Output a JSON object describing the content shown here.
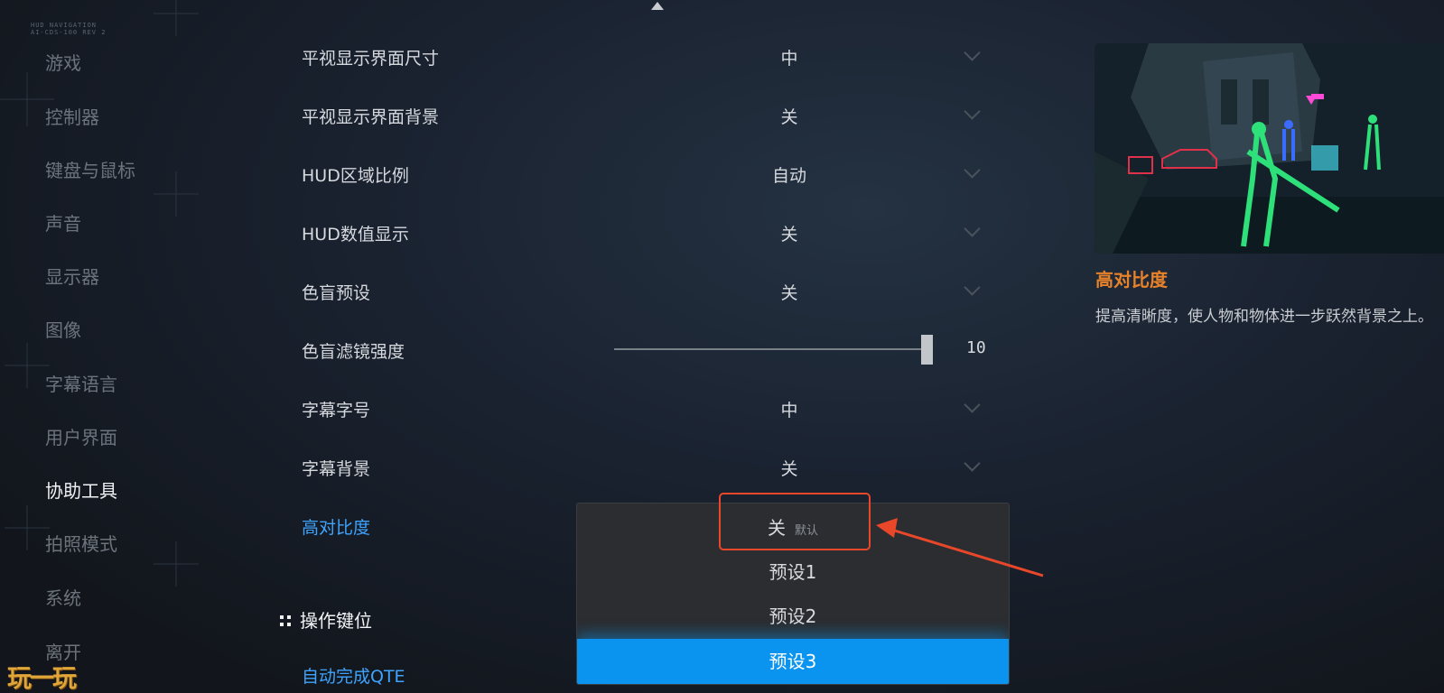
{
  "hud_tag": [
    "HUD NAVIGATION",
    "AI-CDS-100 REV 2"
  ],
  "sidebar": {
    "items": [
      {
        "label": "游戏"
      },
      {
        "label": "控制器"
      },
      {
        "label": "键盘与鼠标"
      },
      {
        "label": "声音"
      },
      {
        "label": "显示器"
      },
      {
        "label": "图像"
      },
      {
        "label": "字幕语言"
      },
      {
        "label": "用户界面"
      },
      {
        "label": "协助工具"
      },
      {
        "label": "拍照模式"
      },
      {
        "label": "系统"
      },
      {
        "label": "离开"
      }
    ],
    "active_label": "协助工具"
  },
  "settings": {
    "rows": [
      {
        "label": "平视显示界面尺寸",
        "value": "中"
      },
      {
        "label": "平视显示界面背景",
        "value": "关"
      },
      {
        "label": "HUD区域比例",
        "value": "自动"
      },
      {
        "label": "HUD数值显示",
        "value": "关"
      },
      {
        "label": "色盲预设",
        "value": "关"
      },
      {
        "label": "色盲滤镜强度",
        "value": "10",
        "slider_fraction": 1.0
      },
      {
        "label": "字幕字号",
        "value": "中"
      },
      {
        "label": "字幕背景",
        "value": "关"
      },
      {
        "label": "高对比度",
        "value": ""
      }
    ],
    "section_header": "操作键位",
    "next_row_label": "自动完成QTE"
  },
  "dropdown": {
    "options": [
      {
        "label": "关",
        "tag": "默认"
      },
      {
        "label": "预设1",
        "tag": ""
      },
      {
        "label": "预设2",
        "tag": ""
      },
      {
        "label": "预设3",
        "tag": ""
      }
    ],
    "selected_label": "预设3"
  },
  "preview": {
    "title": "高对比度",
    "description": "提高清晰度，使人物和物体进一步跃然背景之上。"
  },
  "watermark": "玩一玩",
  "colors": {
    "accent_blue": "#0a94ef",
    "link_blue": "#3ea4ff",
    "title_orange": "#e8822a",
    "annotation_red": "#e8472a"
  }
}
